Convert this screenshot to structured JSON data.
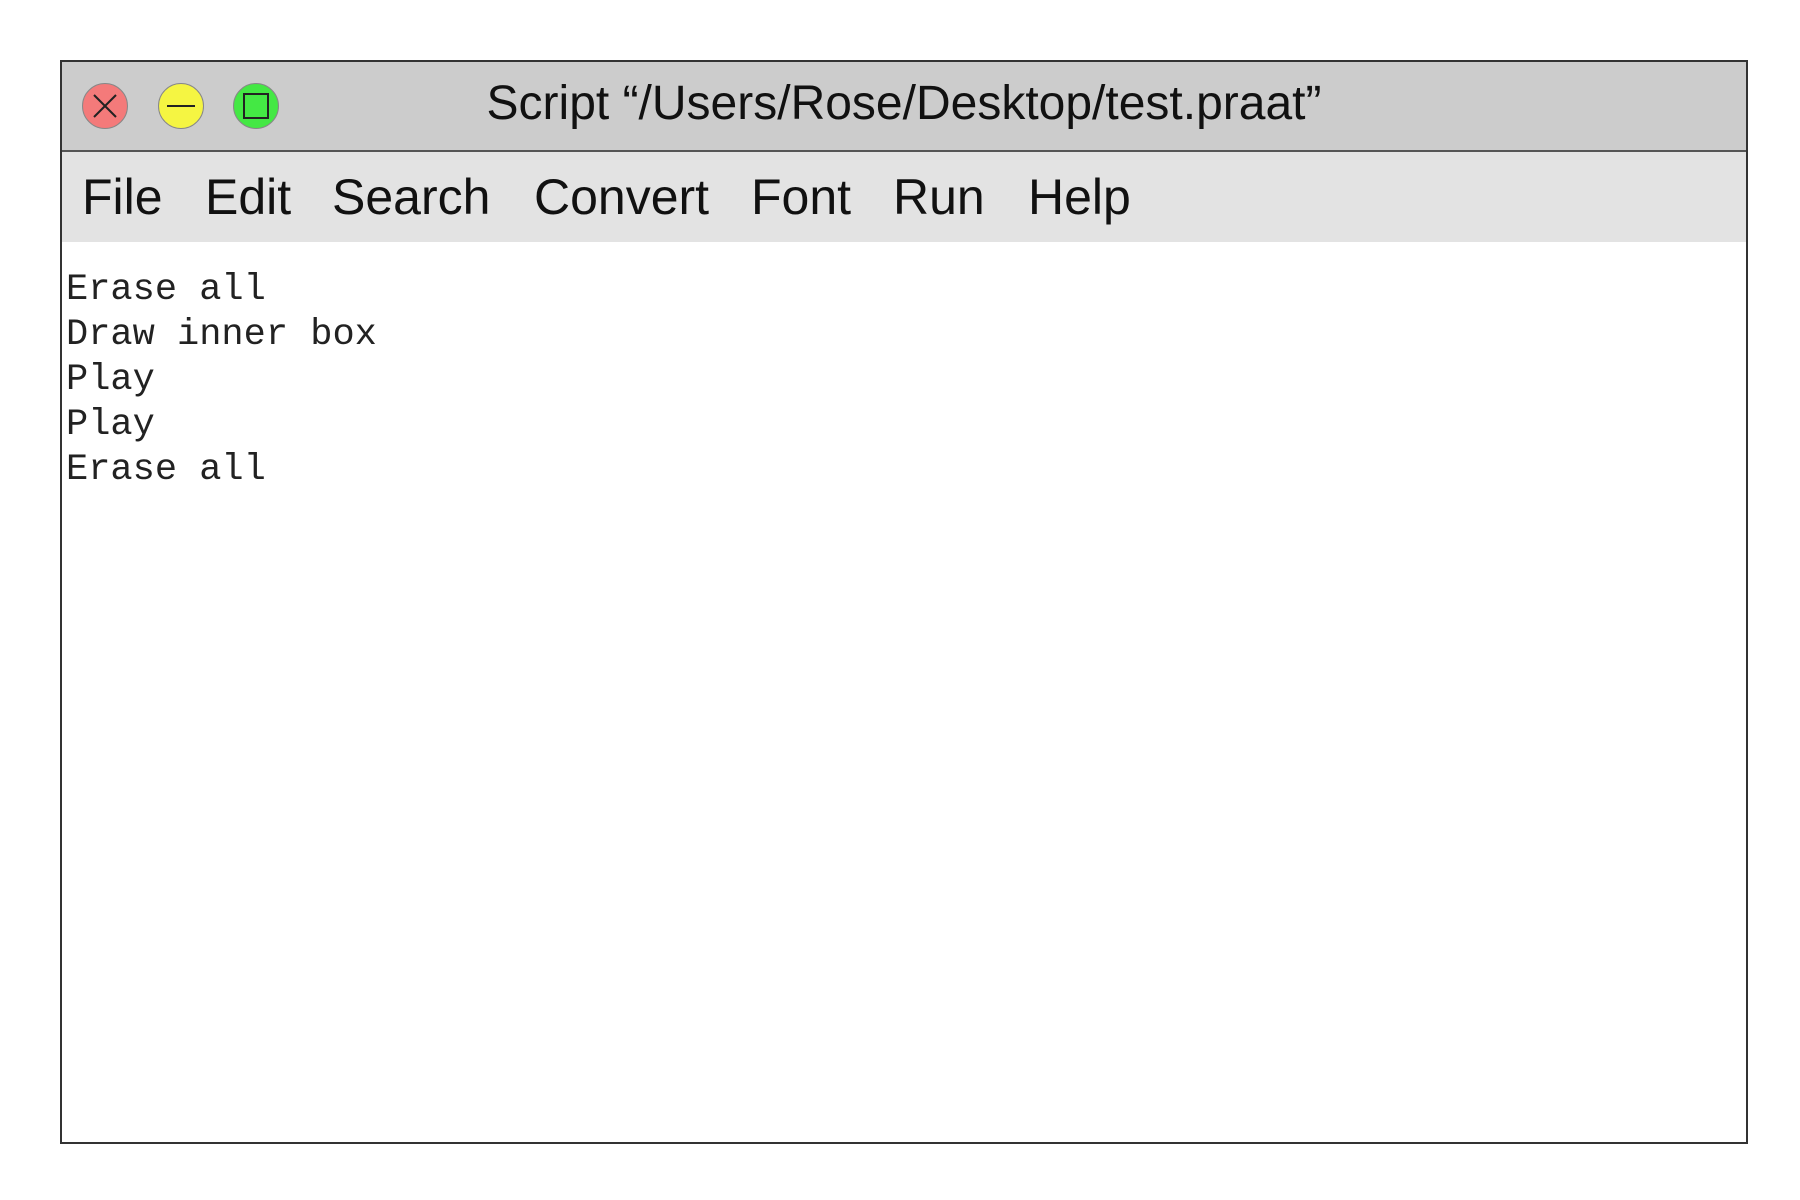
{
  "window": {
    "title": "Script “/Users/Rose/Desktop/test.praat”",
    "controls": {
      "close": {
        "icon": "close-icon",
        "color": "#f47a7a"
      },
      "minimize": {
        "icon": "minimize-icon",
        "color": "#f5f542"
      },
      "maximize": {
        "icon": "maximize-icon",
        "color": "#44e844"
      }
    }
  },
  "menubar": {
    "items": [
      {
        "label": "File"
      },
      {
        "label": "Edit"
      },
      {
        "label": "Search"
      },
      {
        "label": "Convert"
      },
      {
        "label": "Font"
      },
      {
        "label": "Run"
      },
      {
        "label": "Help"
      }
    ]
  },
  "editor": {
    "lines": [
      "Erase all",
      "Draw inner box",
      "Play",
      "Play",
      "Erase all"
    ]
  }
}
